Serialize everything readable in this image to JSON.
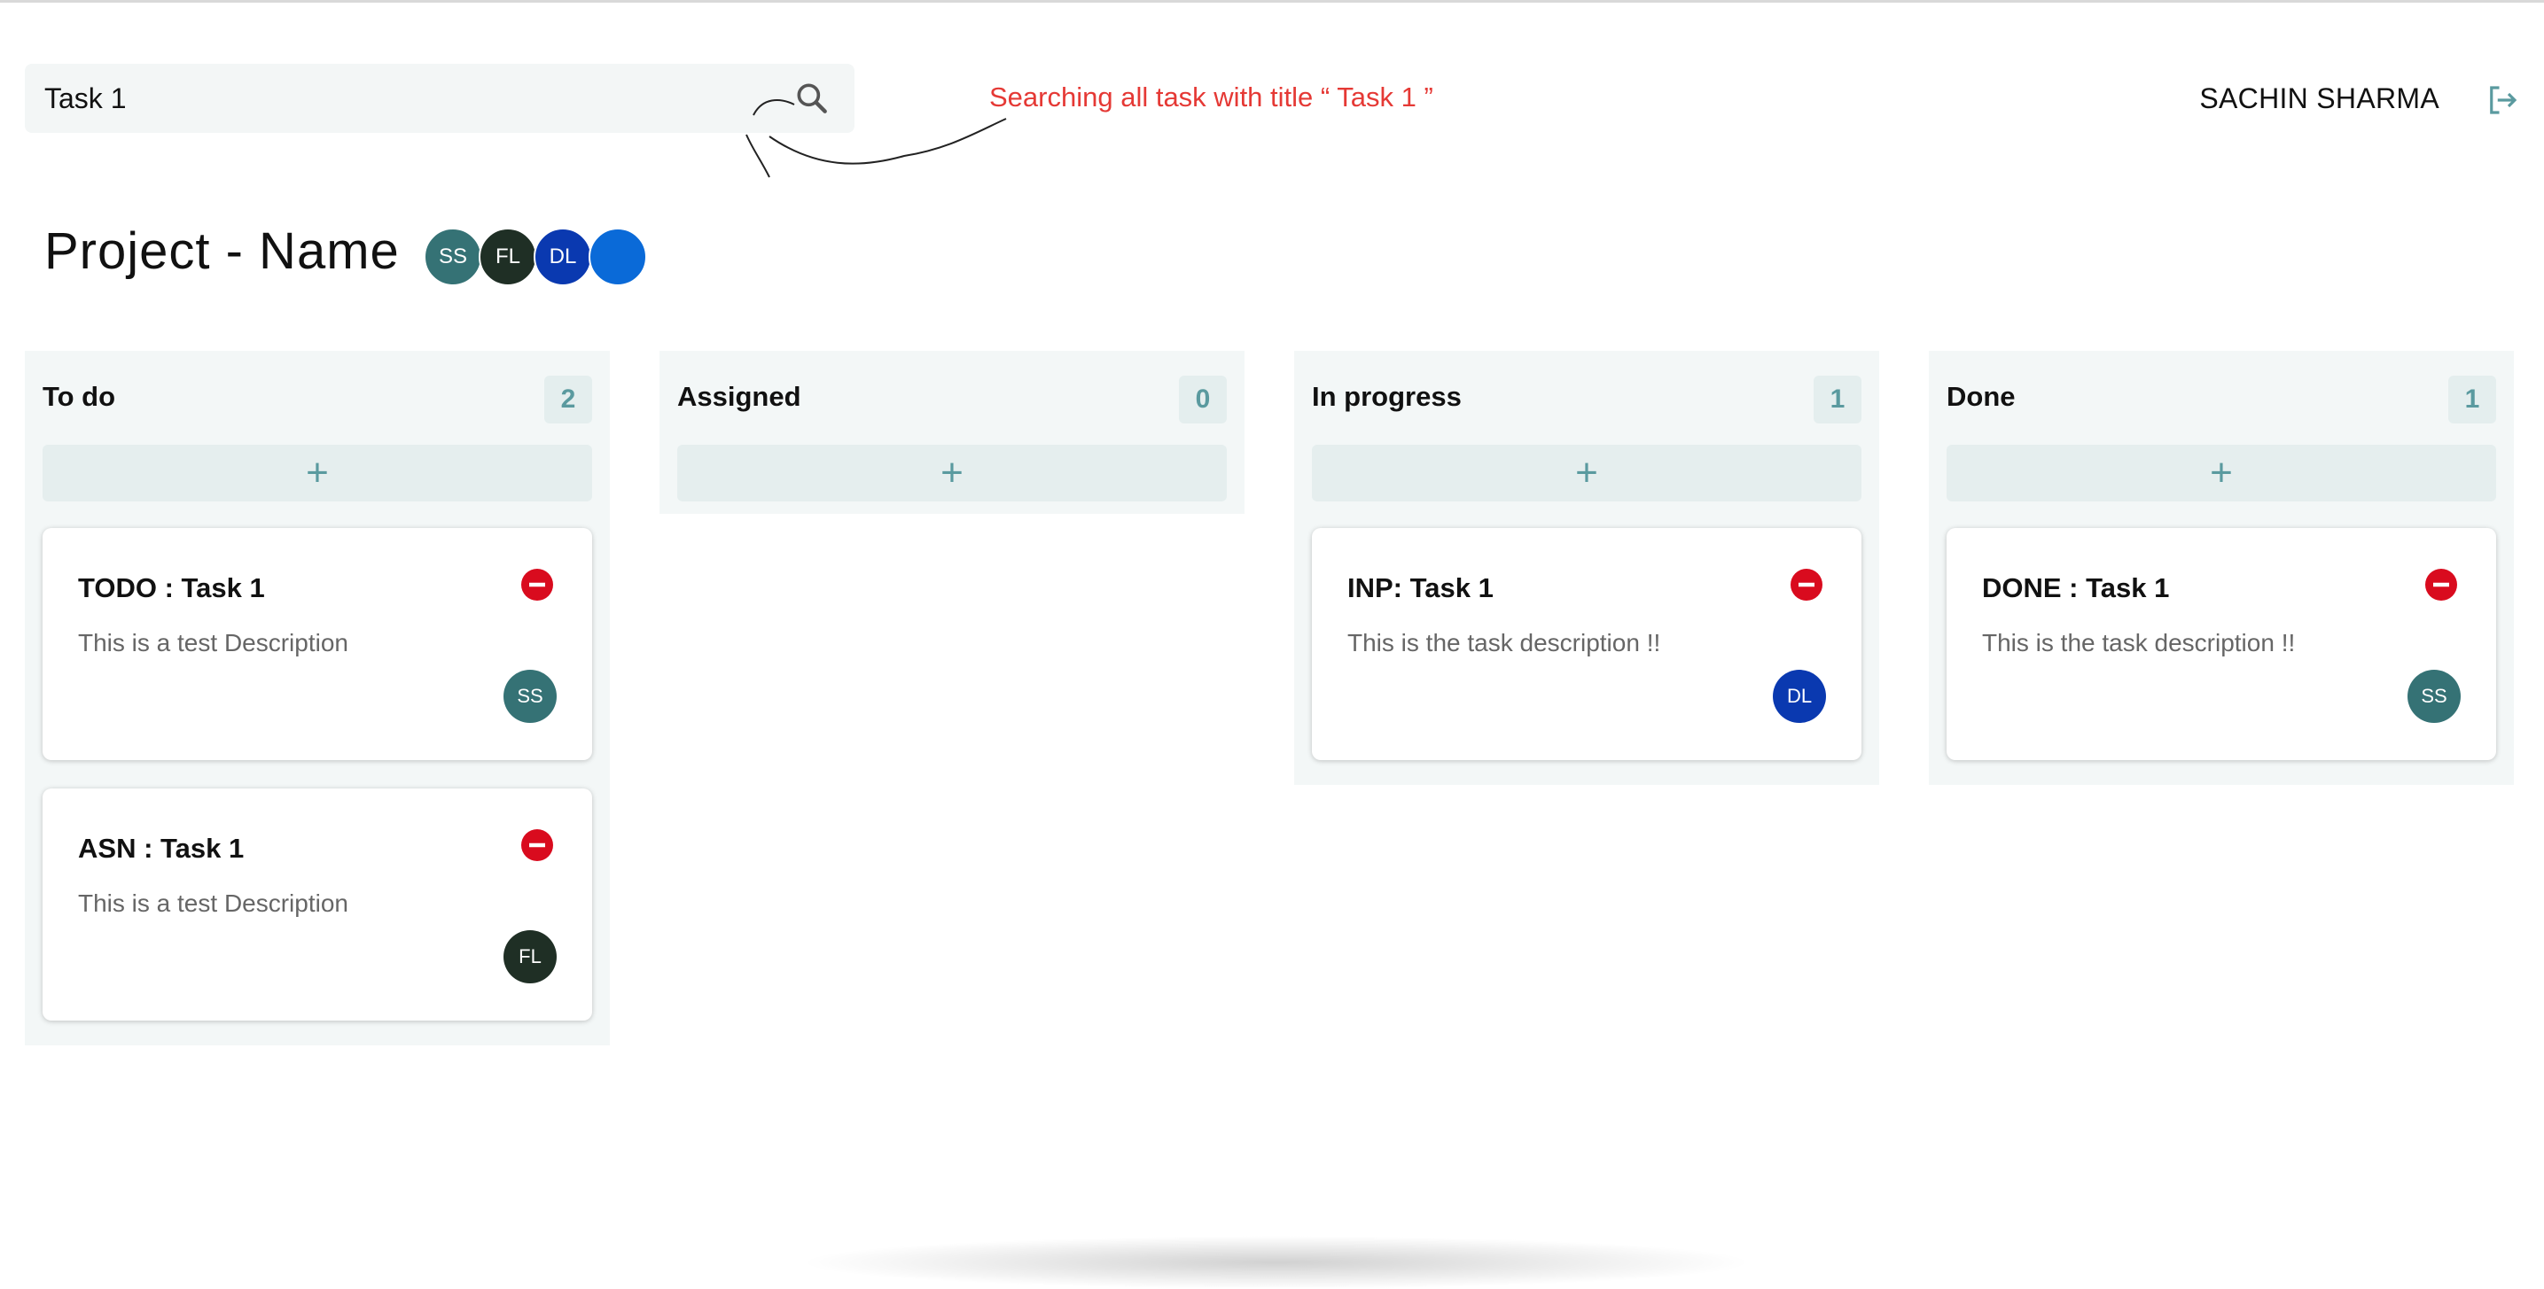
{
  "search": {
    "value": "Task 1"
  },
  "annotation": "Searching all task with title “ Task 1 ”",
  "user": {
    "name": "SACHIN SHARMA"
  },
  "project": {
    "title": "Project - Name",
    "members": [
      {
        "initials": "SS",
        "color": "#357275"
      },
      {
        "initials": "FL",
        "color": "#1f2f25"
      },
      {
        "initials": "DL",
        "color": "#0a39b0"
      },
      {
        "initials": "",
        "color": "#0a6ad8"
      }
    ]
  },
  "add_label": "+",
  "columns": [
    {
      "title": "To do",
      "count": "2",
      "cards": [
        {
          "title": "TODO : Task 1",
          "description": "This is a test Description",
          "assignee": "SS",
          "assignee_color": "#357275"
        },
        {
          "title": "ASN : Task 1",
          "description": "This is a test Description",
          "assignee": "FL",
          "assignee_color": "#1f2f25"
        }
      ]
    },
    {
      "title": "Assigned",
      "count": "0",
      "cards": []
    },
    {
      "title": "In progress",
      "count": "1",
      "cards": [
        {
          "title": "INP: Task 1",
          "description": "This is the task description !!",
          "assignee": "DL",
          "assignee_color": "#0a39b0"
        }
      ]
    },
    {
      "title": "Done",
      "count": "1",
      "cards": [
        {
          "title": "DONE : Task 1",
          "description": "This is the task description !!",
          "assignee": "SS",
          "assignee_color": "#357275"
        }
      ]
    }
  ],
  "icons": {
    "search": "search-icon",
    "logout": "logout-icon",
    "delete": "remove-circle-icon"
  },
  "colors": {
    "accent": "#5a9a9f",
    "danger": "#d90b1e",
    "annotation": "#e53935"
  }
}
